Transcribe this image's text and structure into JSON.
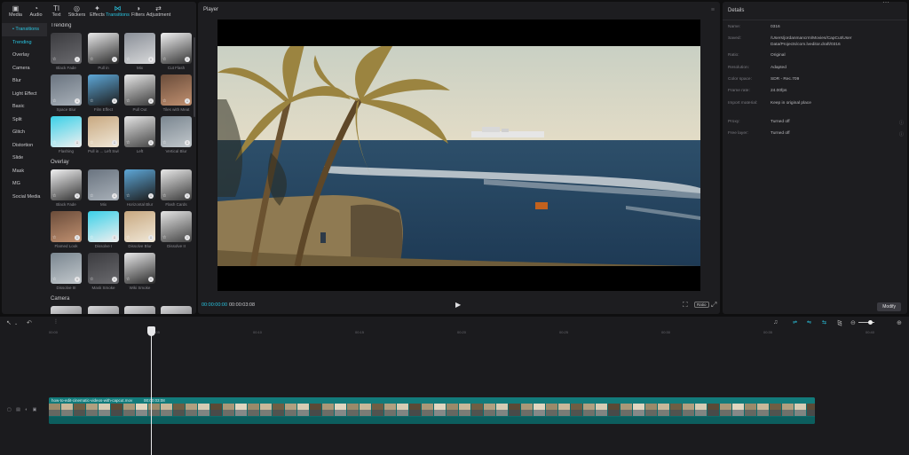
{
  "toolbar": [
    {
      "icon": "▣",
      "label": "Media",
      "active": false
    },
    {
      "icon": "◔",
      "label": "Audio",
      "active": false
    },
    {
      "icon": "TI",
      "label": "Text",
      "active": false
    },
    {
      "icon": "◎",
      "label": "Stickers",
      "active": false
    },
    {
      "icon": "✦",
      "label": "Effects",
      "active": false
    },
    {
      "icon": "⋈",
      "label": "Transitions",
      "active": true
    },
    {
      "icon": "◑",
      "label": "Filters",
      "active": false
    },
    {
      "icon": "⇄",
      "label": "Adjustment",
      "active": false
    }
  ],
  "categories": [
    "• Transitions",
    "Trending",
    "Overlay",
    "Camera",
    "Blur",
    "Light Effect",
    "Basic",
    "Split",
    "Glitch",
    "Distortion",
    "Slide",
    "Mask",
    "MG",
    "Social Media"
  ],
  "sections": [
    {
      "title": "Trending",
      "items": [
        "Black Fade",
        "Pull in",
        "Mix",
        "Cut Flash",
        "Space Blur",
        "Film Effect",
        "Pull Out",
        "Tiles with Meat",
        "Flashing",
        "Pull in ... Left Swift",
        "Left",
        "Vertical Blur"
      ]
    },
    {
      "title": "Overlay",
      "items": [
        "Black Fade",
        "Mix",
        "Horizontal Blur",
        "Flash Cards",
        "Flamed Look",
        "Dissolve I",
        "Dissolve Blur",
        "Dissolve II",
        "Dissolve III",
        "Mask Smoke",
        "Wiki Smoke"
      ]
    },
    {
      "title": "Camera",
      "items": []
    }
  ],
  "player": {
    "title": "Player",
    "menu_icon": "≡",
    "time_current": "00:00:00:00",
    "time_total": "00:00:03:08",
    "ratio_label": "Ratio"
  },
  "details": {
    "title": "Details",
    "rows": [
      {
        "key": "Name:",
        "value": "0316"
      },
      {
        "key": "Saved:",
        "value": "/Users/jordanmancrm/Movies/CapCut/User Data/Projects/com.lveditor.draft/0316"
      },
      {
        "key": "Ratio:",
        "value": "Original"
      },
      {
        "key": "Resolution:",
        "value": "Adapted"
      },
      {
        "key": "Color space:",
        "value": "SDR - Rec.709"
      },
      {
        "key": "Frame rate:",
        "value": "24.00fps"
      },
      {
        "key": "Import material:",
        "value": "Keep in original place"
      },
      {
        "key": "Proxy:",
        "value": "Turned off"
      },
      {
        "key": "Free layer:",
        "value": "Turned off"
      }
    ],
    "modify_label": "Modify"
  },
  "timeline": {
    "ruler": [
      "00:00",
      "00:05",
      "00:10",
      "00:15",
      "00:20",
      "00:25",
      "00:30",
      "00:35",
      "00:40"
    ],
    "clip_name": "how-to-edit-cinematic-videos-with-capcut.mov",
    "clip_duration": "00:00:03:08"
  },
  "colors": {
    "accent": "#29c4e0",
    "clip": "#0e6b6b"
  }
}
